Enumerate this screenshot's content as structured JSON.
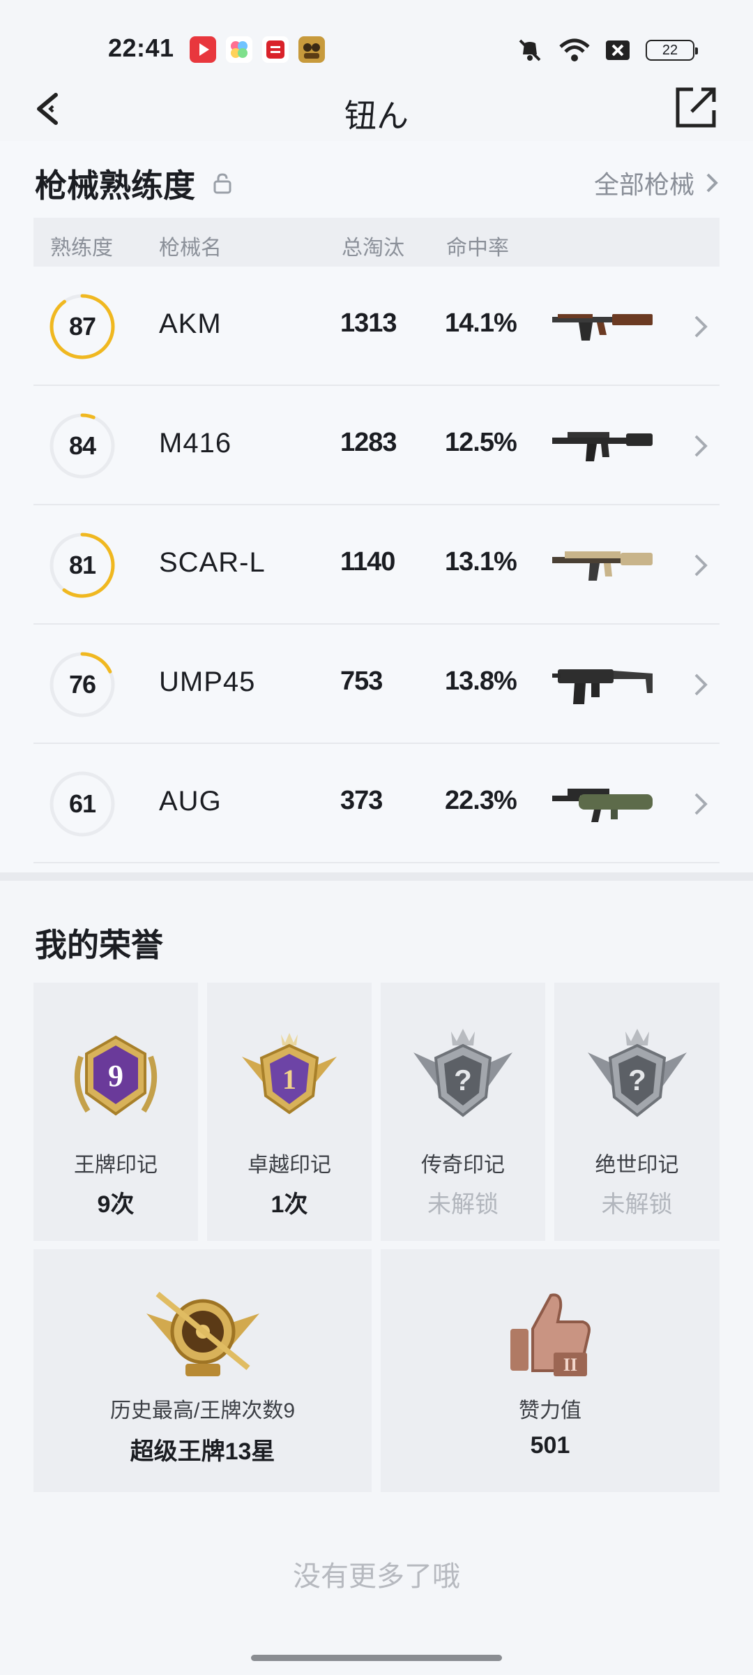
{
  "status_bar": {
    "time": "22:41",
    "battery": "22",
    "icons": [
      "video-app-icon",
      "gallery-app-icon",
      "news-app-icon",
      "game-app-icon",
      "mute-icon",
      "wifi-icon",
      "sim-off-icon",
      "battery-icon"
    ]
  },
  "nav": {
    "title": "钮ん"
  },
  "weapons": {
    "section_title": "枪械熟练度",
    "all_label": "全部枪械",
    "headers": {
      "mastery": "熟练度",
      "name": "枪械名",
      "kills": "总淘汰",
      "accuracy": "命中率"
    },
    "rows": [
      {
        "mastery": "87",
        "name": "AKM",
        "kills": "1313",
        "accuracy": "14.1%",
        "progress": 0.9
      },
      {
        "mastery": "84",
        "name": "M416",
        "kills": "1283",
        "accuracy": "12.5%",
        "progress": 0.06
      },
      {
        "mastery": "81",
        "name": "SCAR-L",
        "kills": "1140",
        "accuracy": "13.1%",
        "progress": 0.6
      },
      {
        "mastery": "76",
        "name": "UMP45",
        "kills": "753",
        "accuracy": "13.8%",
        "progress": 0.18
      },
      {
        "mastery": "61",
        "name": "AUG",
        "kills": "373",
        "accuracy": "22.3%",
        "progress": 0
      }
    ],
    "ring_color": "#f0b820"
  },
  "honors": {
    "section_title": "我的荣誉",
    "badges": [
      {
        "label": "王牌印记",
        "value": "9次",
        "badge_text": "9"
      },
      {
        "label": "卓越印记",
        "value": "1次",
        "badge_text": "1"
      },
      {
        "label": "传奇印记",
        "value": "未解锁",
        "badge_text": "?"
      },
      {
        "label": "绝世印记",
        "value": "未解锁",
        "badge_text": "?"
      }
    ],
    "history": {
      "label": "历史最高/王牌次数9",
      "value": "超级王牌13星"
    },
    "likes": {
      "label": "赞力值",
      "value": "501",
      "badge_text": "II"
    }
  },
  "footer": {
    "no_more": "没有更多了哦"
  }
}
